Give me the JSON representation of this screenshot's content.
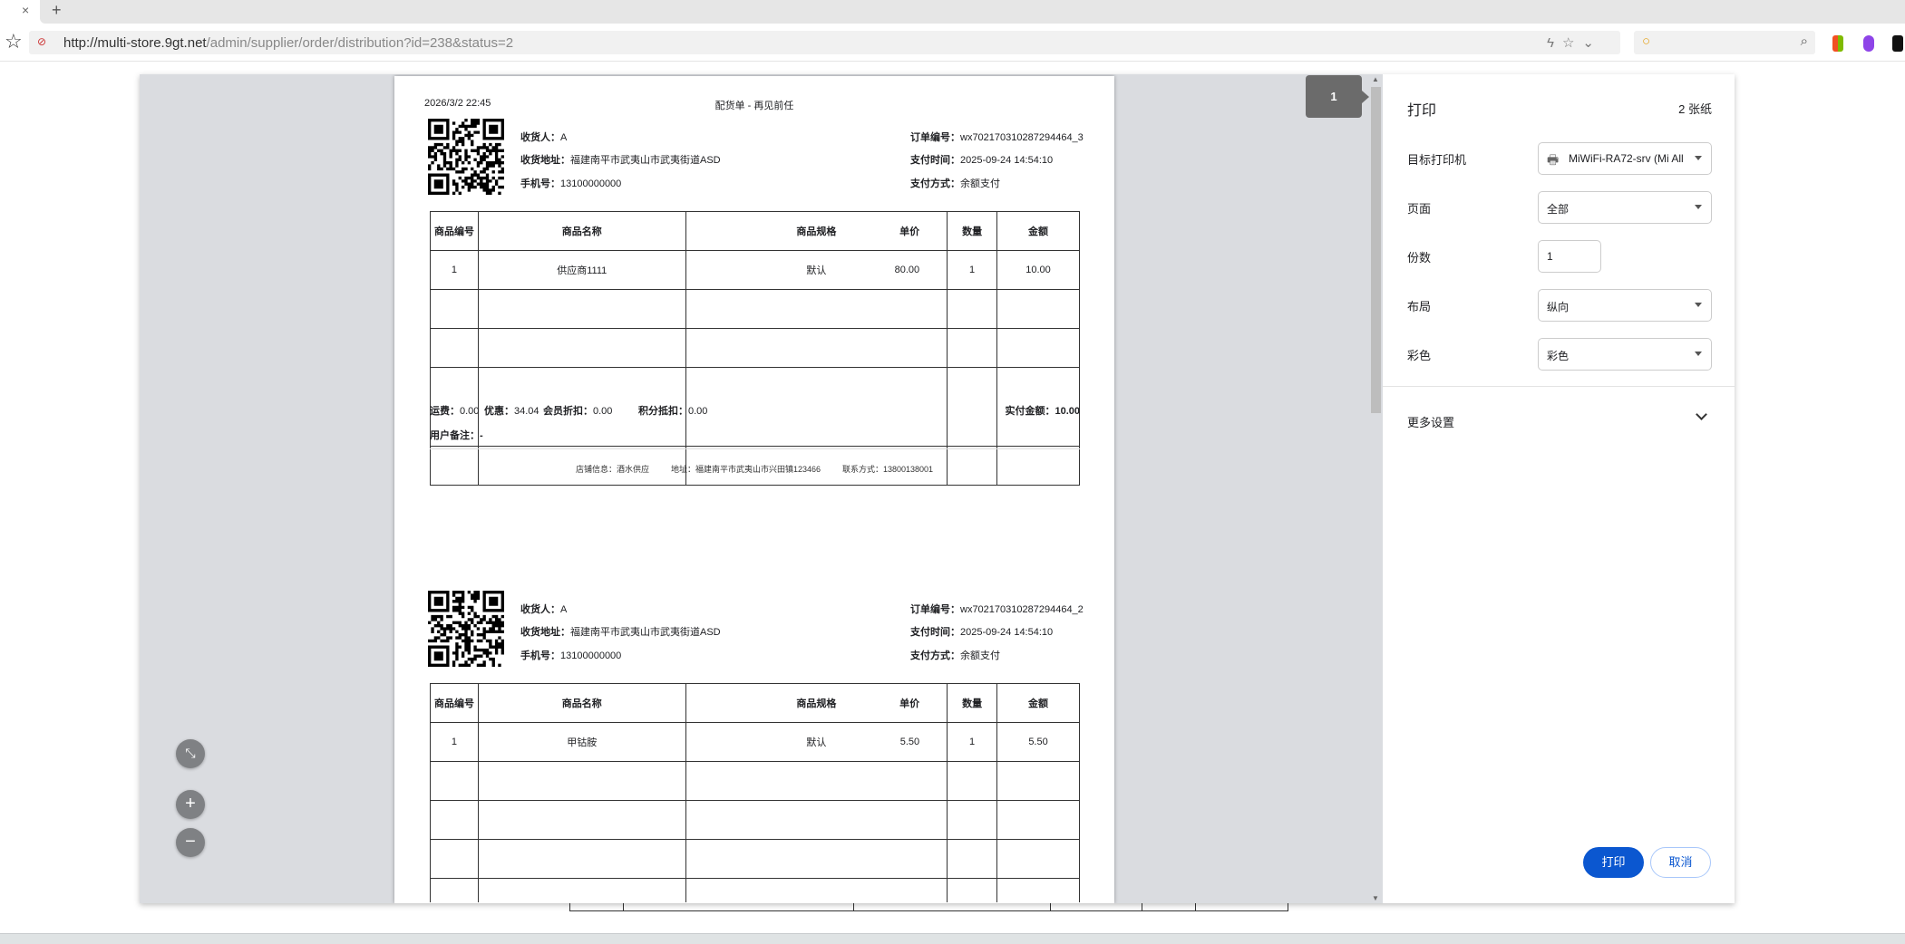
{
  "browser": {
    "url_host": "http://multi-store.9gt.net",
    "url_path": "/admin/supplier/order/distribution?id=238&status=2"
  },
  "document": {
    "print_date": "2026/3/2 22:45",
    "title": "配货单 - 再见前任",
    "labels": {
      "receiver": "收货人：",
      "address": "收货地址：",
      "phone": "手机号：",
      "order_no": "订单编号：",
      "pay_time": "支付时间：",
      "pay_method": "支付方式：",
      "shipping": "运费：",
      "discount": "优惠：",
      "member_discount": "会员折扣：",
      "points": "积分抵扣：",
      "paid": "实付金额：",
      "remark": "用户备注："
    },
    "columns": [
      "商品编号",
      "商品名称",
      "商品规格",
      "单价",
      "数量",
      "金额"
    ],
    "shop": {
      "name": "店铺信息：酒水供应",
      "address": "地址：福建南平市武夷山市兴田镇123466",
      "contact": "联系方式：13800138001"
    },
    "orders": [
      {
        "receiver": "A",
        "address": "福建南平市武夷山市武夷街道ASD",
        "phone": "13100000000",
        "order_no": "wx702170310287294464_3",
        "pay_time": "2025-09-24 14:54:10",
        "pay_method": "余额支付",
        "items": [
          {
            "no": "1",
            "name": "供应商1111",
            "spec": "默认",
            "price": "80.00",
            "qty": "1",
            "amount": "10.00"
          }
        ],
        "shipping": "0.00",
        "discount": "34.04",
        "member_discount": "0.00",
        "points": "0.00",
        "paid": "10.00",
        "remark": "-"
      },
      {
        "receiver": "A",
        "address": "福建南平市武夷山市武夷街道ASD",
        "phone": "13100000000",
        "order_no": "wx702170310287294464_2",
        "pay_time": "2025-09-24 14:54:10",
        "pay_method": "余额支付",
        "items": [
          {
            "no": "1",
            "name": "甲钴胺",
            "spec": "默认",
            "price": "5.50",
            "qty": "1",
            "amount": "5.50"
          }
        ]
      }
    ]
  },
  "preview": {
    "page_number": "1"
  },
  "panel": {
    "title": "打印",
    "sheets": "2 张纸",
    "printer_label": "目标打印机",
    "printer_value": "MiWiFi-RA72-srv (Mi All",
    "pages_label": "页面",
    "pages_value": "全部",
    "copies_label": "份数",
    "copies_value": "1",
    "layout_label": "布局",
    "layout_value": "纵向",
    "color_label": "彩色",
    "color_value": "彩色",
    "more_settings": "更多设置",
    "print_button": "打印",
    "cancel_button": "取消"
  },
  "colors": {
    "accent": "#0b57d0"
  }
}
